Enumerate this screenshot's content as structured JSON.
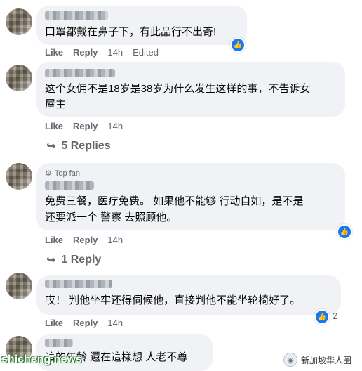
{
  "colors": {
    "bubble": "#f0f2f5",
    "meta": "#65676b",
    "like_blue": "#1877f2"
  },
  "comments": [
    {
      "text_lines": [
        "口罩都戴在鼻子下，有此品行不出奇!"
      ],
      "like": "Like",
      "reply": "Reply",
      "time": "14h",
      "edited": "Edited"
    },
    {
      "text_lines": [
        "这个女佣不是18岁是38岁为什么发生这样的事，不告诉女",
        "屋主"
      ],
      "like": "Like",
      "reply": "Reply",
      "time": "14h",
      "replies": "5 Replies"
    },
    {
      "badge": "Top fan",
      "text_lines": [
        "免费三餐，医疗免费。 如果他不能够 行动自如，是不是",
        "还要派一个 警察 去照顾他。"
      ],
      "like": "Like",
      "reply": "Reply",
      "time": "14h",
      "replies": "1 Reply"
    },
    {
      "text_lines": [
        "哎！ 判他坐牢还得伺候他，直接判他不能坐轮椅好了。"
      ],
      "like": "Like",
      "reply": "Reply",
      "time": "14h",
      "reaction_count": "2"
    },
    {
      "text_lines": [
        "這的年齡 還在這樣想 人老不尊"
      ]
    }
  ],
  "watermarks": {
    "left": "shicheng.news",
    "right": "新加坡华人圈"
  }
}
